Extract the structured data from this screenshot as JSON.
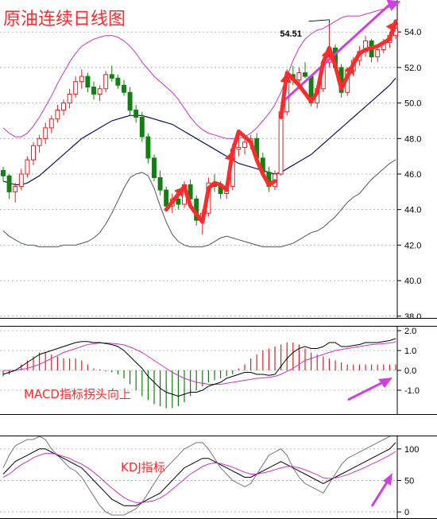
{
  "chart_data": {
    "type": "candlestick",
    "title": "原油连续日线图",
    "price_axis": {
      "ticks": [
        "54.0",
        "52.0",
        "50.0",
        "48.0",
        "46.0",
        "44.0",
        "42.0",
        "40.0",
        "38.0"
      ],
      "ylim": [
        37.9,
        55.8
      ]
    },
    "peak_label": "54.51",
    "candles": [
      [
        46.2,
        46.4,
        45.6,
        45.9
      ],
      [
        45.9,
        46.0,
        44.6,
        45.0
      ],
      [
        45.0,
        45.5,
        44.4,
        45.3
      ],
      [
        45.3,
        46.3,
        45.1,
        46.0
      ],
      [
        46.0,
        47.0,
        45.8,
        46.8
      ],
      [
        46.8,
        47.8,
        46.5,
        47.6
      ],
      [
        47.6,
        48.2,
        47.2,
        48.0
      ],
      [
        48.0,
        48.9,
        47.7,
        48.6
      ],
      [
        48.6,
        49.3,
        48.3,
        49.1
      ],
      [
        49.1,
        49.9,
        48.9,
        49.6
      ],
      [
        49.6,
        50.2,
        49.3,
        50.0
      ],
      [
        50.0,
        50.8,
        49.7,
        50.5
      ],
      [
        50.5,
        51.5,
        50.3,
        51.2
      ],
      [
        51.2,
        51.9,
        50.8,
        51.5
      ],
      [
        51.5,
        51.7,
        50.6,
        50.9
      ],
      [
        50.9,
        51.2,
        50.2,
        50.5
      ],
      [
        50.5,
        51.0,
        50.1,
        50.8
      ],
      [
        50.8,
        51.8,
        50.6,
        51.6
      ],
      [
        51.6,
        52.1,
        51.2,
        51.4
      ],
      [
        51.4,
        51.6,
        50.8,
        51.0
      ],
      [
        51.0,
        51.3,
        50.4,
        50.6
      ],
      [
        50.6,
        50.9,
        49.3,
        49.6
      ],
      [
        49.6,
        49.9,
        48.9,
        49.2
      ],
      [
        49.2,
        49.5,
        47.8,
        48.1
      ],
      [
        48.1,
        48.3,
        46.6,
        46.9
      ],
      [
        46.9,
        47.1,
        45.6,
        45.8
      ],
      [
        45.8,
        46.2,
        44.8,
        45.1
      ],
      [
        45.1,
        45.3,
        43.9,
        44.2
      ],
      [
        44.2,
        44.9,
        43.8,
        44.6
      ],
      [
        44.6,
        45.0,
        44.0,
        44.3
      ],
      [
        44.3,
        45.6,
        44.1,
        45.4
      ],
      [
        45.4,
        45.7,
        44.3,
        44.6
      ],
      [
        44.6,
        44.8,
        43.1,
        43.4
      ],
      [
        43.4,
        44.0,
        42.6,
        43.8
      ],
      [
        43.8,
        45.8,
        43.6,
        45.5
      ],
      [
        45.5,
        46.0,
        45.0,
        45.3
      ],
      [
        45.3,
        45.6,
        44.6,
        44.9
      ],
      [
        44.9,
        45.5,
        44.6,
        45.3
      ],
      [
        45.3,
        47.7,
        45.1,
        47.4
      ],
      [
        47.4,
        48.3,
        47.0,
        47.5
      ],
      [
        47.5,
        48.0,
        47.1,
        47.8
      ],
      [
        47.8,
        48.2,
        47.4,
        48.0
      ],
      [
        48.0,
        48.3,
        46.6,
        46.9
      ],
      [
        46.9,
        47.2,
        45.8,
        46.1
      ],
      [
        46.1,
        46.4,
        45.0,
        45.3
      ],
      [
        45.3,
        46.2,
        45.1,
        46.0
      ],
      [
        46.0,
        49.8,
        45.9,
        49.5
      ],
      [
        49.5,
        51.9,
        49.3,
        51.6
      ],
      [
        51.6,
        52.1,
        51.0,
        51.3
      ],
      [
        51.3,
        52.0,
        50.8,
        51.7
      ],
      [
        51.7,
        52.3,
        51.4,
        51.5
      ],
      [
        51.5,
        51.6,
        49.8,
        50.0
      ],
      [
        50.0,
        51.0,
        49.7,
        50.8
      ],
      [
        50.8,
        52.5,
        50.6,
        52.3
      ],
      [
        52.3,
        54.51,
        52.0,
        53.1
      ],
      [
        53.1,
        53.3,
        51.8,
        52.0
      ],
      [
        52.0,
        52.2,
        50.3,
        50.6
      ],
      [
        50.6,
        52.0,
        50.4,
        51.8
      ],
      [
        51.8,
        52.6,
        51.5,
        52.4
      ],
      [
        52.4,
        53.2,
        52.1,
        52.9
      ],
      [
        52.9,
        53.8,
        52.6,
        53.5
      ],
      [
        53.5,
        53.6,
        52.3,
        52.6
      ],
      [
        52.6,
        53.2,
        52.3,
        53.0
      ],
      [
        53.0,
        53.6,
        52.8,
        53.4
      ],
      [
        53.4,
        54.0,
        53.1,
        53.8
      ],
      [
        53.8,
        54.5,
        53.6,
        54.2
      ]
    ],
    "ma": [
      45.6,
      45.5,
      45.4,
      45.4,
      45.5,
      45.7,
      45.9,
      46.2,
      46.5,
      46.8,
      47.1,
      47.4,
      47.7,
      48.0,
      48.2,
      48.4,
      48.6,
      48.8,
      49.0,
      49.1,
      49.2,
      49.3,
      49.3,
      49.3,
      49.2,
      49.1,
      49.0,
      48.9,
      48.8,
      48.6,
      48.4,
      48.2,
      48.0,
      47.8,
      47.6,
      47.4,
      47.2,
      47.0,
      46.8,
      46.6,
      46.5,
      46.4,
      46.3,
      46.2,
      46.1,
      46.0,
      46.1,
      46.3,
      46.5,
      46.7,
      46.9,
      47.1,
      47.4,
      47.7,
      48.0,
      48.3,
      48.6,
      48.9,
      49.2,
      49.5,
      49.8,
      50.1,
      50.4,
      50.7,
      51.0,
      51.4
    ],
    "boll_upper": [
      48.6,
      48.3,
      48.1,
      48.1,
      48.3,
      48.7,
      49.2,
      49.8,
      50.4,
      51.1,
      51.7,
      52.3,
      52.8,
      53.2,
      53.4,
      53.6,
      53.7,
      53.8,
      53.8,
      53.7,
      53.5,
      53.2,
      52.8,
      52.3,
      51.9,
      51.5,
      51.2,
      50.9,
      50.6,
      50.2,
      49.7,
      49.2,
      48.8,
      48.5,
      48.3,
      48.2,
      48.1,
      48.0,
      48.0,
      48.0,
      48.1,
      48.3,
      48.6,
      49.0,
      49.4,
      49.9,
      50.6,
      51.5,
      52.4,
      53.1,
      53.6,
      53.9,
      54.1,
      54.2,
      54.4,
      54.6,
      54.8,
      54.9,
      54.9,
      54.9,
      55.0,
      55.1,
      55.2,
      55.3,
      55.4,
      55.5
    ],
    "boll_lower": [
      42.8,
      42.5,
      42.3,
      42.1,
      42.0,
      42.0,
      41.9,
      41.9,
      41.9,
      41.9,
      42.0,
      42.0,
      42.0,
      42.1,
      42.2,
      42.4,
      42.7,
      43.2,
      43.8,
      44.5,
      45.2,
      45.8,
      46.0,
      46.1,
      45.9,
      45.2,
      44.2,
      43.3,
      42.6,
      42.2,
      42.0,
      41.9,
      41.9,
      41.9,
      42.0,
      42.2,
      42.4,
      42.5,
      42.4,
      42.3,
      42.2,
      42.1,
      42.0,
      41.9,
      41.9,
      41.9,
      41.9,
      42.0,
      42.1,
      42.3,
      42.5,
      42.7,
      42.8,
      43.0,
      43.3,
      43.6,
      44.0,
      44.4,
      44.7,
      44.9,
      45.3,
      45.7,
      46.0,
      46.3,
      46.6,
      46.8
    ],
    "macd": {
      "ticks": [
        "2.0",
        "1.0",
        "0.0",
        "-1.0"
      ],
      "ylim": [
        -2.2,
        2.2
      ],
      "annotation": "MACD指标拐头向上",
      "dif": [
        -0.2,
        -0.1,
        0.0,
        0.2,
        0.4,
        0.6,
        0.8,
        0.9,
        1.0,
        1.1,
        1.2,
        1.3,
        1.4,
        1.45,
        1.45,
        1.4,
        1.4,
        1.35,
        1.3,
        1.2,
        1.0,
        0.7,
        0.4,
        0.1,
        -0.3,
        -0.6,
        -0.9,
        -1.1,
        -1.2,
        -1.3,
        -1.2,
        -1.1,
        -1.1,
        -1.0,
        -0.8,
        -0.7,
        -0.6,
        -0.4,
        -0.3,
        -0.2,
        -0.1,
        -0.1,
        -0.2,
        -0.2,
        -0.25,
        -0.2,
        0.2,
        0.6,
        0.9,
        1.1,
        1.2,
        1.1,
        1.1,
        1.2,
        1.4,
        1.4,
        1.2,
        1.2,
        1.25,
        1.3,
        1.4,
        1.4,
        1.4,
        1.45,
        1.5,
        1.6
      ],
      "dea": [
        0.0,
        0.0,
        0.0,
        0.05,
        0.1,
        0.2,
        0.3,
        0.45,
        0.6,
        0.75,
        0.9,
        1.0,
        1.1,
        1.2,
        1.3,
        1.35,
        1.38,
        1.38,
        1.36,
        1.33,
        1.28,
        1.18,
        1.05,
        0.9,
        0.7,
        0.5,
        0.3,
        0.1,
        -0.1,
        -0.25,
        -0.4,
        -0.5,
        -0.6,
        -0.65,
        -0.7,
        -0.7,
        -0.7,
        -0.65,
        -0.6,
        -0.55,
        -0.5,
        -0.45,
        -0.4,
        -0.38,
        -0.35,
        -0.3,
        -0.2,
        -0.05,
        0.1,
        0.3,
        0.5,
        0.6,
        0.7,
        0.8,
        0.9,
        1.0,
        1.05,
        1.1,
        1.15,
        1.2,
        1.25,
        1.3,
        1.32,
        1.35,
        1.38,
        1.42
      ],
      "hist": [
        -0.3,
        -0.2,
        0.0,
        0.3,
        0.5,
        0.7,
        0.9,
        0.9,
        0.8,
        0.7,
        0.6,
        0.6,
        0.6,
        0.5,
        0.3,
        0.1,
        0.05,
        -0.05,
        -0.1,
        -0.2,
        -0.4,
        -0.7,
        -1.0,
        -1.3,
        -1.5,
        -1.7,
        -1.8,
        -1.9,
        -1.9,
        -1.8,
        -1.6,
        -1.3,
        -1.0,
        -0.8,
        -0.6,
        -0.5,
        -0.4,
        -0.3,
        -0.2,
        0.1,
        0.3,
        0.6,
        0.8,
        1.0,
        1.1,
        1.2,
        1.3,
        1.4,
        1.4,
        1.3,
        1.1,
        0.9,
        0.8,
        0.7,
        0.6,
        0.5,
        0.4,
        0.3,
        0.3,
        0.3,
        0.3,
        0.3,
        0.3,
        0.3,
        0.3,
        0.3
      ]
    },
    "kdj": {
      "ticks": [
        "100",
        "50",
        "0"
      ],
      "ylim": [
        -10,
        120
      ],
      "annotation": "KDJ指标",
      "k": [
        60,
        70,
        80,
        85,
        90,
        95,
        100,
        100,
        95,
        90,
        85,
        80,
        75,
        70,
        60,
        50,
        40,
        30,
        20,
        15,
        10,
        10,
        10,
        15,
        20,
        25,
        30,
        40,
        50,
        60,
        70,
        75,
        80,
        85,
        85,
        80,
        75,
        70,
        65,
        60,
        55,
        55,
        60,
        65,
        70,
        75,
        80,
        75,
        70,
        65,
        60,
        55,
        50,
        45,
        50,
        55,
        60,
        65,
        70,
        75,
        80,
        85,
        90,
        95,
        100,
        110
      ],
      "d": [
        55,
        60,
        68,
        75,
        80,
        86,
        90,
        93,
        93,
        91,
        88,
        85,
        80,
        76,
        70,
        63,
        55,
        46,
        38,
        30,
        23,
        18,
        15,
        15,
        16,
        18,
        22,
        28,
        36,
        44,
        52,
        60,
        66,
        72,
        76,
        78,
        77,
        74,
        71,
        67,
        63,
        60,
        60,
        62,
        64,
        67,
        70,
        72,
        72,
        70,
        67,
        63,
        59,
        54,
        53,
        54,
        56,
        59,
        63,
        67,
        71,
        76,
        80,
        85,
        90,
        96
      ],
      "j": [
        70,
        90,
        105,
        110,
        115,
        115,
        120,
        115,
        100,
        90,
        80,
        70,
        65,
        55,
        40,
        25,
        10,
        0,
        -5,
        -5,
        -5,
        0,
        5,
        15,
        30,
        45,
        60,
        70,
        80,
        90,
        100,
        105,
        110,
        110,
        100,
        85,
        70,
        60,
        50,
        45,
        40,
        45,
        60,
        75,
        90,
        95,
        100,
        90,
        70,
        55,
        45,
        40,
        35,
        30,
        45,
        60,
        75,
        85,
        90,
        95,
        100,
        105,
        110,
        115,
        120,
        125
      ]
    }
  }
}
